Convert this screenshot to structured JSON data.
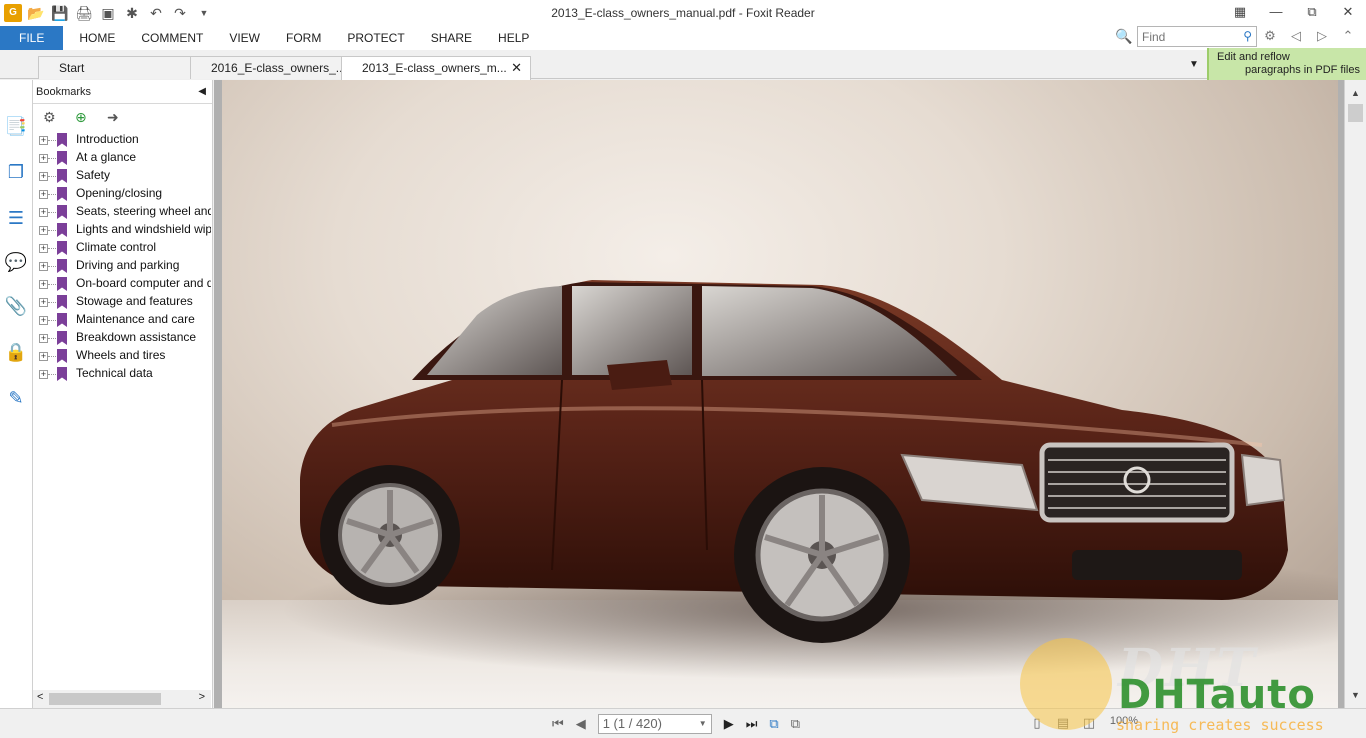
{
  "window": {
    "title": "2013_E-class_owners_manual.pdf - Foxit Reader",
    "app_logo": "G"
  },
  "quick_access": [
    "app-logo",
    "open-icon",
    "save-icon",
    "print-icon",
    "screen-icon",
    "new-icon",
    "undo-icon",
    "redo-icon",
    "customize-dropdown-icon"
  ],
  "menu": {
    "file": "FILE",
    "items": [
      "HOME",
      "COMMENT",
      "VIEW",
      "FORM",
      "PROTECT",
      "SHARE",
      "HELP"
    ]
  },
  "find": {
    "placeholder": "Find"
  },
  "tabs": [
    {
      "label": "Start",
      "active": false
    },
    {
      "label": "2016_E-class_owners_...",
      "active": false
    },
    {
      "label": "2013_E-class_owners_m...",
      "active": true
    }
  ],
  "promo": {
    "line1": "Edit and reflow",
    "line2": "paragraphs in PDF files"
  },
  "bookmarks": {
    "header": "Bookmarks",
    "items": [
      "Introduction",
      "At a glance",
      "Safety",
      "Opening/closing",
      "Seats, steering wheel and mirrors",
      "Lights and windshield wipers",
      "Climate control",
      "Driving and parking",
      "On-board computer and displays",
      "Stowage and features",
      "Maintenance and care",
      "Breakdown assistance",
      "Wheels and tires",
      "Technical data"
    ]
  },
  "status": {
    "page_indicator": "1 (1 / 420)",
    "zoom": "100%"
  },
  "watermark": {
    "text_top": "DHT",
    "brand": "DHTauto",
    "slogan": "sharing creates success"
  },
  "colors": {
    "accent": "#2b78c5",
    "bookmark_flag": "#7b3f99",
    "car_body": "#5a2418",
    "promo_bg": "#c8e6a8"
  }
}
